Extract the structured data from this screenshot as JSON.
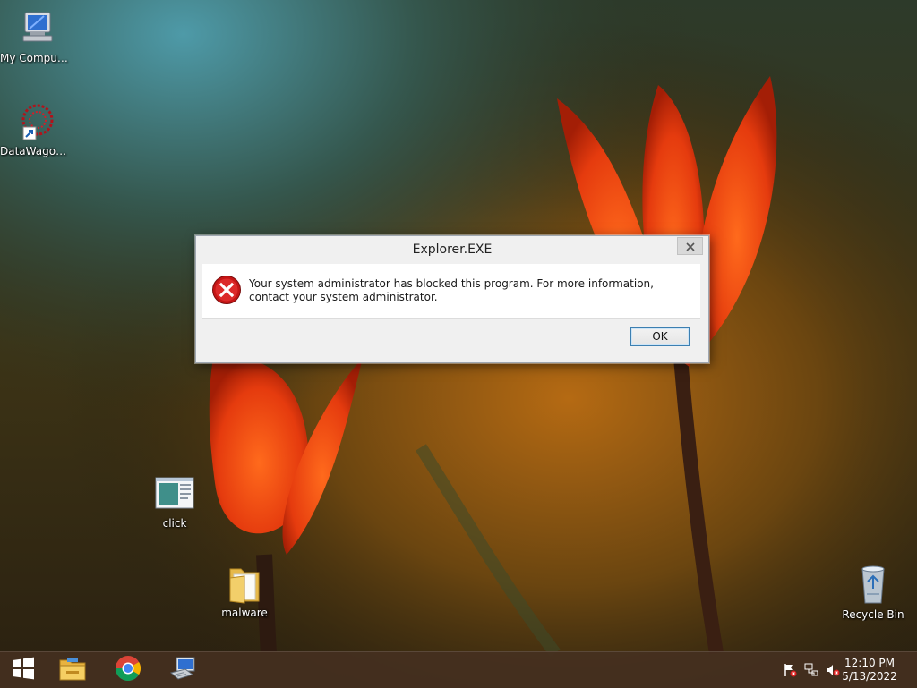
{
  "desktop": {
    "icons": {
      "my_computer": "My Computer",
      "datawagon": "DataWagon...",
      "click": "click",
      "malware": "malware",
      "recycle_bin": "Recycle Bin"
    }
  },
  "dialog": {
    "title": "Explorer.EXE",
    "message": "Your system administrator has blocked this program. For more information, contact your system administrator.",
    "ok_label": "OK",
    "icon": "error-icon"
  },
  "taskbar": {
    "pinned": [
      "start-icon",
      "file-explorer-icon",
      "chrome-icon",
      "network-computer-icon"
    ],
    "tray": [
      "action-center-flag-icon",
      "network-icon",
      "volume-muted-icon"
    ],
    "time": "12:10 PM",
    "date": "5/13/2022"
  }
}
